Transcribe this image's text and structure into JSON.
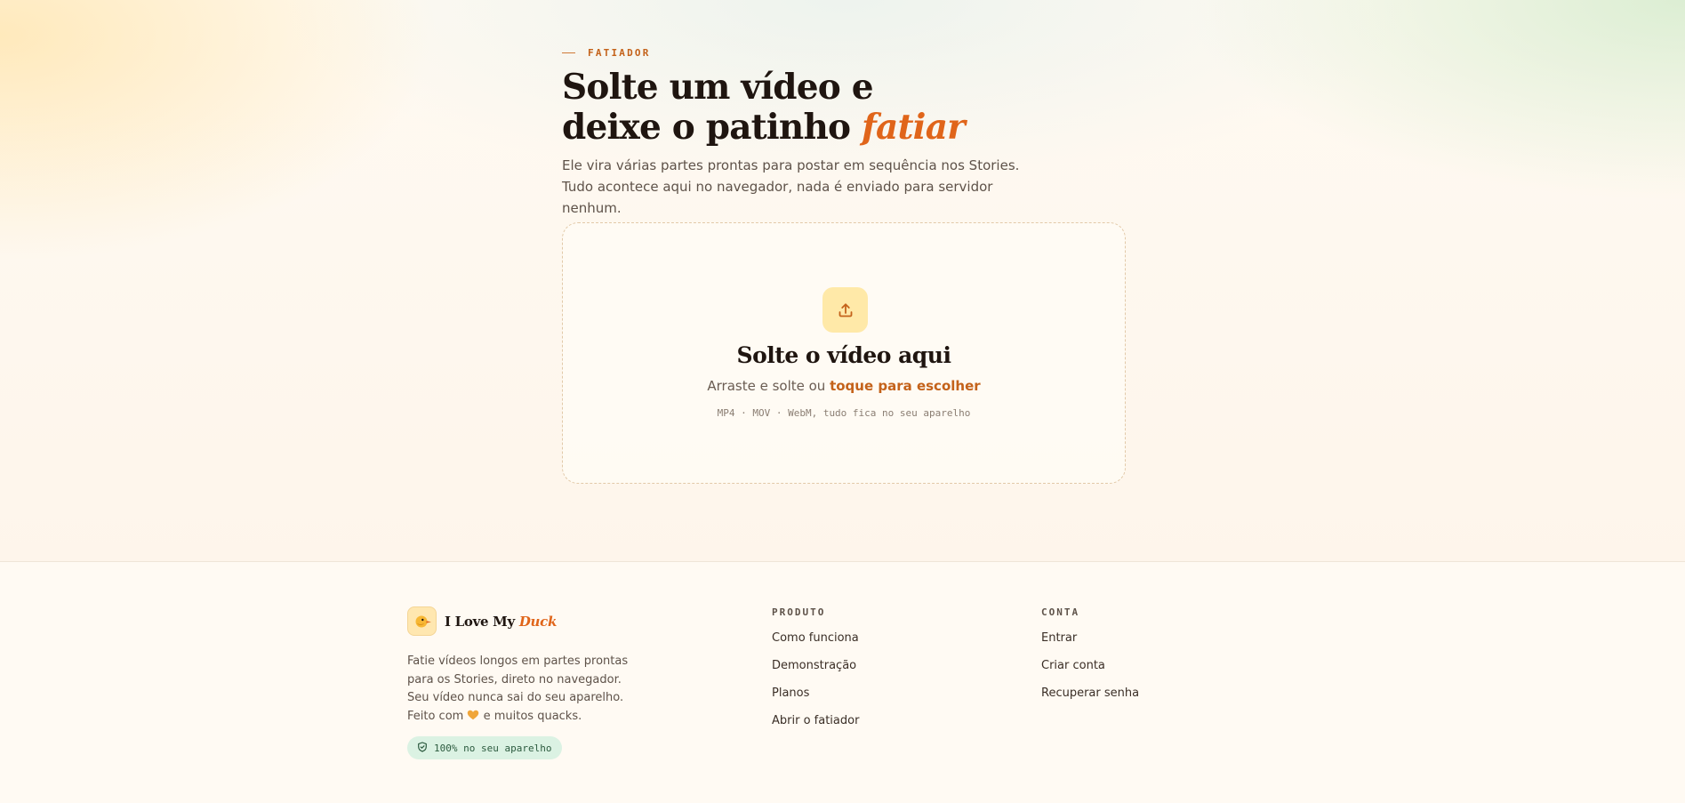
{
  "hero": {
    "eyebrow": "FATIADOR",
    "title_line1": "Solte um vídeo e",
    "title_line2_prefix": "deixe o patinho ",
    "title_line2_accent": "fatiar",
    "subtitle": "Ele vira várias partes prontas para postar em sequência nos Stories. Tudo acontece aqui no navegador, nada é enviado para servidor nenhum."
  },
  "dropzone": {
    "icon": "upload-icon",
    "title": "Solte o vídeo aqui",
    "subtitle_prefix": "Arraste e solte ou ",
    "subtitle_link": "toque para escolher",
    "formats": "MP4 · MOV · WebM, tudo fica no seu aparelho"
  },
  "footer": {
    "brand_prefix": "I Love My ",
    "brand_accent": "Duck",
    "description_before_icon": "Fatie vídeos longos em partes prontas para os Stories, direto no navegador. Seu vídeo nunca sai do seu aparelho. Feito com ",
    "description_after_icon": " e muitos quacks.",
    "badge": "100% no seu aparelho",
    "product": {
      "heading": "PRODUTO",
      "links": [
        "Como funciona",
        "Demonstração",
        "Planos",
        "Abrir o fatiador"
      ]
    },
    "account": {
      "heading": "CONTA",
      "links": [
        "Entrar",
        "Criar conta",
        "Recuperar senha"
      ]
    }
  },
  "colors": {
    "accent": "#e0651a",
    "link": "#c4621a",
    "heading": "#1f1510",
    "badge_bg": "#dbf2e3",
    "upload_bg": "#ffe9a8"
  }
}
